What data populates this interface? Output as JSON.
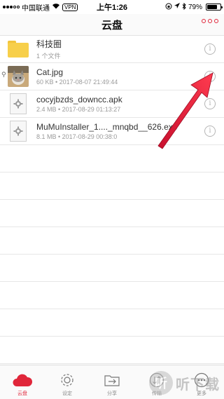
{
  "status_bar": {
    "carrier": "中国联通",
    "vpn": "VPN",
    "time": "上午1:26",
    "battery": "79%",
    "battery_level": 0.79
  },
  "nav": {
    "title": "云盘"
  },
  "files": [
    {
      "name": "科技圈",
      "meta": "1 个文件",
      "kind": "folder",
      "icon": "folder-icon"
    },
    {
      "name": "Cat.jpg",
      "meta": "60 KB • 2017-08-07 21:49:44",
      "kind": "image",
      "icon": "image-thumbnail"
    },
    {
      "name": "cocyjbzds_downcc.apk",
      "meta": "2.4 MB • 2017-08-29 01:13:27",
      "kind": "file",
      "icon": "gear-icon"
    },
    {
      "name": "MuMuInstaller_1...._mnqbd__626.exe",
      "meta": "8.1 MB • 2017-08-29 00:38:0",
      "kind": "file",
      "icon": "gear-icon"
    }
  ],
  "tabs": [
    {
      "label": "云盘",
      "icon": "cloud-icon",
      "active": true
    },
    {
      "label": "设定",
      "icon": "gear-icon",
      "active": false
    },
    {
      "label": "分享",
      "icon": "share-icon",
      "active": false
    },
    {
      "label": "传输",
      "icon": "transfer-icon",
      "active": false
    },
    {
      "label": "更多",
      "icon": "more-icon",
      "active": false
    }
  ],
  "watermark": {
    "glyph": "听",
    "text": "听下载"
  },
  "colors": {
    "accent": "#e0263a",
    "folder": "#f7cf4a"
  }
}
